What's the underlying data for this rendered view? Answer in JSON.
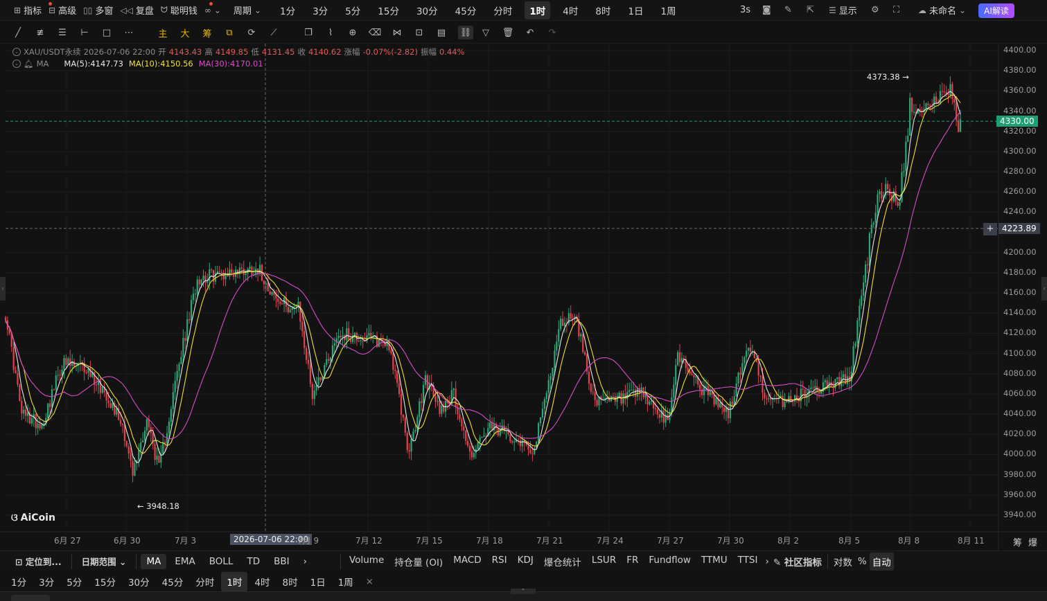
{
  "topbar": {
    "items": [
      {
        "icon": "indicator-icon",
        "label": "指标",
        "dot": true
      },
      {
        "icon": "advanced-icon",
        "label": "高级"
      },
      {
        "icon": "multi-window-icon",
        "label": "多窗"
      },
      {
        "icon": "replay-icon",
        "label": "复盘"
      },
      {
        "icon": "smart-money-icon",
        "label": "聪明钱",
        "dot": true
      }
    ],
    "period_label": "周期",
    "timeframes": [
      "1分",
      "3分",
      "5分",
      "15分",
      "30分",
      "45分",
      "分时",
      "1时",
      "4时",
      "8时",
      "1日",
      "1周"
    ],
    "active_timeframe": "1时",
    "refresh": "3s",
    "display_label": "显示",
    "account_label": "未命名",
    "ai_label": "AI解读"
  },
  "tools": {
    "main": "主",
    "big": "大",
    "chips": "筹"
  },
  "legend": {
    "symbol": "XAU/USDT永续",
    "datetime": "2026-07-06 22:00",
    "open_label": "开",
    "open": "4143.43",
    "high_label": "高",
    "high": "4149.85",
    "low_label": "低",
    "low": "4131.45",
    "close_label": "收",
    "close": "4140.62",
    "change_label": "涨幅",
    "change": "-0.07%(-2.82)",
    "amp_label": "振幅",
    "amp": "0.44%",
    "ma_label": "MA",
    "ma5": "MA(5):4147.73",
    "ma10": "MA(10):4150.56",
    "ma30": "MA(30):4170.01"
  },
  "colors": {
    "ma5": "#e8e8e8",
    "ma10": "#f0e030",
    "ma30": "#d84bc8",
    "up": "#2aa876",
    "down": "#e0424e",
    "price_tag": "#1f9e74"
  },
  "chart_data": {
    "type": "candlestick",
    "symbol": "XAU/USDT永续",
    "interval": "1时",
    "ylim": [
      3930,
      4405
    ],
    "y_ticks": [
      3940,
      3960,
      3980,
      4000,
      4020,
      4040,
      4060,
      4080,
      4100,
      4120,
      4140,
      4160,
      4180,
      4200,
      4240,
      4260,
      4280,
      4300,
      4320,
      4340,
      4360,
      4380,
      4400
    ],
    "x_ticks": [
      "6月 27",
      "6月 30",
      "7月 3",
      "7月 9",
      "7月 12",
      "7月 15",
      "7月 18",
      "7月 21",
      "7月 24",
      "7月 27",
      "7月 30",
      "8月 2",
      "8月 5",
      "8月 8",
      "8月 11"
    ],
    "crosshair_date": "2026-07-06 22:00",
    "current_price": "4330.00",
    "crosshair_price": "4223.89",
    "max_label": "4373.38",
    "min_label": "3948.18",
    "anchors": [
      [
        0,
        4140
      ],
      [
        8,
        4040
      ],
      [
        18,
        4030
      ],
      [
        28,
        4090
      ],
      [
        40,
        4085
      ],
      [
        50,
        4060
      ],
      [
        58,
        4030
      ],
      [
        63,
        3980
      ],
      [
        70,
        4035
      ],
      [
        76,
        3985
      ],
      [
        85,
        4080
      ],
      [
        95,
        4175
      ],
      [
        110,
        4180
      ],
      [
        125,
        4185
      ],
      [
        135,
        4150
      ],
      [
        145,
        4145
      ],
      [
        152,
        4060
      ],
      [
        165,
        4120
      ],
      [
        178,
        4115
      ],
      [
        190,
        4110
      ],
      [
        200,
        4000
      ],
      [
        208,
        4075
      ],
      [
        215,
        4045
      ],
      [
        222,
        4060
      ],
      [
        230,
        4000
      ],
      [
        240,
        4025
      ],
      [
        250,
        4020
      ],
      [
        262,
        4005
      ],
      [
        275,
        4130
      ],
      [
        282,
        4140
      ],
      [
        292,
        4050
      ],
      [
        305,
        4055
      ],
      [
        315,
        4060
      ],
      [
        328,
        4030
      ],
      [
        333,
        4100
      ],
      [
        345,
        4065
      ],
      [
        358,
        4040
      ],
      [
        368,
        4110
      ],
      [
        378,
        4050
      ],
      [
        390,
        4055
      ],
      [
        400,
        4065
      ],
      [
        418,
        4075
      ],
      [
        428,
        4210
      ],
      [
        435,
        4270
      ],
      [
        442,
        4245
      ],
      [
        448,
        4340
      ],
      [
        460,
        4350
      ],
      [
        468,
        4360
      ],
      [
        472,
        4325
      ]
    ]
  },
  "indicators": {
    "locate_label": "定位到...",
    "date_range_label": "日期范围",
    "main": [
      "MA",
      "EMA",
      "BOLL",
      "TD",
      "BBI"
    ],
    "active_main": "MA",
    "sub": [
      "Volume",
      "持仓量 (OI)",
      "MACD",
      "RSI",
      "KDJ",
      "爆仓统计",
      "LSUR",
      "FR",
      "Fundflow",
      "TTMU",
      "TTSI"
    ],
    "community_label": "社区指标",
    "log_label": "对数",
    "pct_label": "%",
    "auto_label": "自动",
    "right_a": "筹",
    "right_b": "爆"
  },
  "timeframes_bottom": [
    "1分",
    "3分",
    "5分",
    "15分",
    "30分",
    "45分",
    "分时",
    "1时",
    "4时",
    "8时",
    "1日",
    "1周"
  ],
  "active_bottom_tf": "1时",
  "watermark": "AiCoin"
}
